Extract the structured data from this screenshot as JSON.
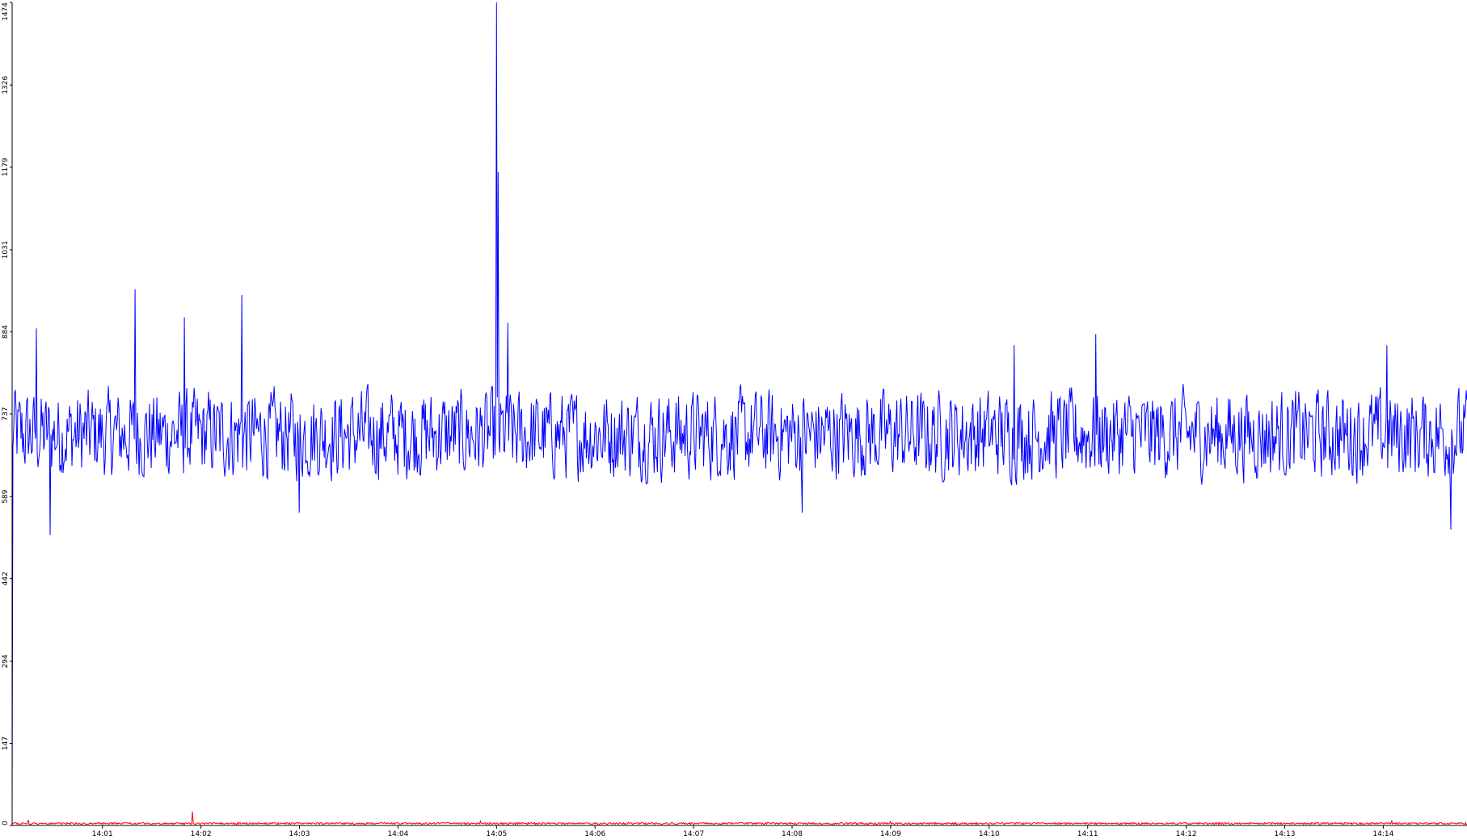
{
  "chart_data": {
    "type": "line",
    "title": "",
    "xlabel": "",
    "ylabel": "",
    "ylim": [
      0,
      1474
    ],
    "y_ticks": [
      "0",
      "147",
      "294",
      "442",
      "589",
      "737",
      "884",
      "1031",
      "1179",
      "1326",
      "1474"
    ],
    "x_ticks": [
      "14:01",
      "14:02",
      "14:03",
      "14:04",
      "14:05",
      "14:06",
      "14:07",
      "14:08",
      "14:09",
      "14:10",
      "14:11",
      "14:12",
      "14:13",
      "14:14"
    ],
    "x_range": [
      "14:00:05",
      "14:14:51"
    ],
    "grid": false,
    "legend": "none",
    "series": [
      {
        "color": "#0000ff",
        "baseline": 700,
        "noise_amplitude": 55,
        "anchor_points": [
          {
            "t": "14:00:05",
            "y": 30
          },
          {
            "t": "14:00:07",
            "y": 780
          },
          {
            "t": "14:00:20",
            "y": 890
          },
          {
            "t": "14:00:28",
            "y": 520
          },
          {
            "t": "14:01:20",
            "y": 960
          },
          {
            "t": "14:01:50",
            "y": 910
          },
          {
            "t": "14:02:25",
            "y": 950
          },
          {
            "t": "14:03:00",
            "y": 560
          },
          {
            "t": "14:05:00",
            "y": 1474
          },
          {
            "t": "14:05:01",
            "y": 1170
          },
          {
            "t": "14:05:07",
            "y": 900
          },
          {
            "t": "14:08:06",
            "y": 560
          },
          {
            "t": "14:10:15",
            "y": 860
          },
          {
            "t": "14:11:05",
            "y": 880
          },
          {
            "t": "14:14:02",
            "y": 860
          },
          {
            "t": "14:14:41",
            "y": 530
          }
        ]
      },
      {
        "color": "#ff0000",
        "baseline": 2,
        "noise_amplitude": 4,
        "anchor_points": [
          {
            "t": "14:01:55",
            "y": 25
          },
          {
            "t": "14:00:15",
            "y": 10
          },
          {
            "t": "14:04:50",
            "y": 8
          },
          {
            "t": "14:09:00",
            "y": 7
          },
          {
            "t": "14:14:05",
            "y": 9
          }
        ]
      }
    ]
  }
}
